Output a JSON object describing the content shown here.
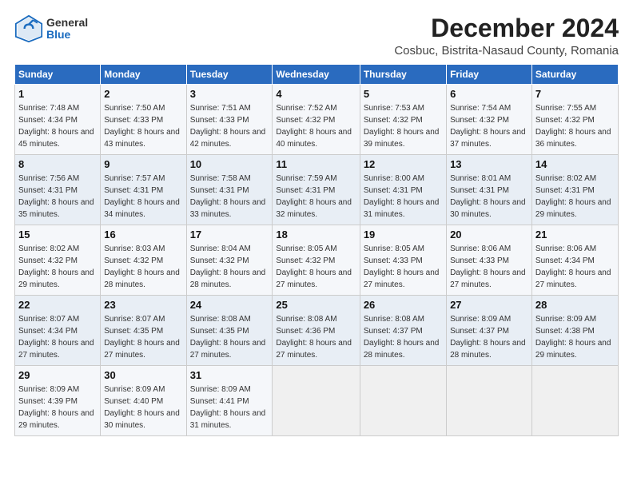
{
  "header": {
    "logo_general": "General",
    "logo_blue": "Blue",
    "main_title": "December 2024",
    "subtitle": "Cosbuc, Bistrita-Nasaud County, Romania"
  },
  "calendar": {
    "days_of_week": [
      "Sunday",
      "Monday",
      "Tuesday",
      "Wednesday",
      "Thursday",
      "Friday",
      "Saturday"
    ],
    "weeks": [
      [
        {
          "day": "1",
          "rise": "7:48 AM",
          "set": "4:34 PM",
          "daylight": "8 hours and 45 minutes."
        },
        {
          "day": "2",
          "rise": "7:50 AM",
          "set": "4:33 PM",
          "daylight": "8 hours and 43 minutes."
        },
        {
          "day": "3",
          "rise": "7:51 AM",
          "set": "4:33 PM",
          "daylight": "8 hours and 42 minutes."
        },
        {
          "day": "4",
          "rise": "7:52 AM",
          "set": "4:32 PM",
          "daylight": "8 hours and 40 minutes."
        },
        {
          "day": "5",
          "rise": "7:53 AM",
          "set": "4:32 PM",
          "daylight": "8 hours and 39 minutes."
        },
        {
          "day": "6",
          "rise": "7:54 AM",
          "set": "4:32 PM",
          "daylight": "8 hours and 37 minutes."
        },
        {
          "day": "7",
          "rise": "7:55 AM",
          "set": "4:32 PM",
          "daylight": "8 hours and 36 minutes."
        }
      ],
      [
        {
          "day": "8",
          "rise": "7:56 AM",
          "set": "4:31 PM",
          "daylight": "8 hours and 35 minutes."
        },
        {
          "day": "9",
          "rise": "7:57 AM",
          "set": "4:31 PM",
          "daylight": "8 hours and 34 minutes."
        },
        {
          "day": "10",
          "rise": "7:58 AM",
          "set": "4:31 PM",
          "daylight": "8 hours and 33 minutes."
        },
        {
          "day": "11",
          "rise": "7:59 AM",
          "set": "4:31 PM",
          "daylight": "8 hours and 32 minutes."
        },
        {
          "day": "12",
          "rise": "8:00 AM",
          "set": "4:31 PM",
          "daylight": "8 hours and 31 minutes."
        },
        {
          "day": "13",
          "rise": "8:01 AM",
          "set": "4:31 PM",
          "daylight": "8 hours and 30 minutes."
        },
        {
          "day": "14",
          "rise": "8:02 AM",
          "set": "4:31 PM",
          "daylight": "8 hours and 29 minutes."
        }
      ],
      [
        {
          "day": "15",
          "rise": "8:02 AM",
          "set": "4:32 PM",
          "daylight": "8 hours and 29 minutes."
        },
        {
          "day": "16",
          "rise": "8:03 AM",
          "set": "4:32 PM",
          "daylight": "8 hours and 28 minutes."
        },
        {
          "day": "17",
          "rise": "8:04 AM",
          "set": "4:32 PM",
          "daylight": "8 hours and 28 minutes."
        },
        {
          "day": "18",
          "rise": "8:05 AM",
          "set": "4:32 PM",
          "daylight": "8 hours and 27 minutes."
        },
        {
          "day": "19",
          "rise": "8:05 AM",
          "set": "4:33 PM",
          "daylight": "8 hours and 27 minutes."
        },
        {
          "day": "20",
          "rise": "8:06 AM",
          "set": "4:33 PM",
          "daylight": "8 hours and 27 minutes."
        },
        {
          "day": "21",
          "rise": "8:06 AM",
          "set": "4:34 PM",
          "daylight": "8 hours and 27 minutes."
        }
      ],
      [
        {
          "day": "22",
          "rise": "8:07 AM",
          "set": "4:34 PM",
          "daylight": "8 hours and 27 minutes."
        },
        {
          "day": "23",
          "rise": "8:07 AM",
          "set": "4:35 PM",
          "daylight": "8 hours and 27 minutes."
        },
        {
          "day": "24",
          "rise": "8:08 AM",
          "set": "4:35 PM",
          "daylight": "8 hours and 27 minutes."
        },
        {
          "day": "25",
          "rise": "8:08 AM",
          "set": "4:36 PM",
          "daylight": "8 hours and 27 minutes."
        },
        {
          "day": "26",
          "rise": "8:08 AM",
          "set": "4:37 PM",
          "daylight": "8 hours and 28 minutes."
        },
        {
          "day": "27",
          "rise": "8:09 AM",
          "set": "4:37 PM",
          "daylight": "8 hours and 28 minutes."
        },
        {
          "day": "28",
          "rise": "8:09 AM",
          "set": "4:38 PM",
          "daylight": "8 hours and 29 minutes."
        }
      ],
      [
        {
          "day": "29",
          "rise": "8:09 AM",
          "set": "4:39 PM",
          "daylight": "8 hours and 29 minutes."
        },
        {
          "day": "30",
          "rise": "8:09 AM",
          "set": "4:40 PM",
          "daylight": "8 hours and 30 minutes."
        },
        {
          "day": "31",
          "rise": "8:09 AM",
          "set": "4:41 PM",
          "daylight": "8 hours and 31 minutes."
        },
        null,
        null,
        null,
        null
      ]
    ]
  }
}
